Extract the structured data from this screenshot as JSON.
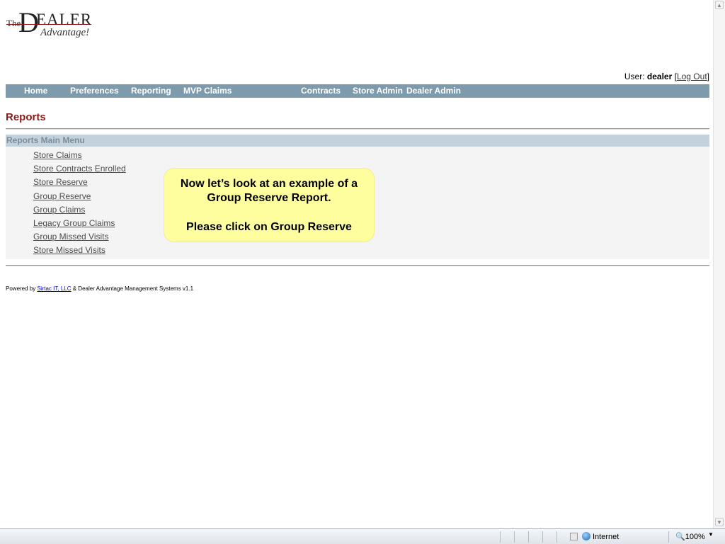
{
  "logo": {
    "the": "The",
    "d": "D",
    "ealer": "EALER",
    "advantage": "Advantage!"
  },
  "user": {
    "prefix": "User:",
    "name": "dealer",
    "bracket_open": "[",
    "logout": "Log Out",
    "bracket_close": "]"
  },
  "nav": {
    "items": [
      "Home",
      "Preferences",
      "Reporting",
      "MVP Claims",
      "Contracts",
      "Store Admin",
      "Dealer Admin"
    ]
  },
  "page": {
    "title": "Reports"
  },
  "menu": {
    "header": "Reports Main Menu",
    "items": [
      "Store Claims",
      "Store Contracts Enrolled",
      "Store Reserve",
      "Group Reserve",
      "Group Claims",
      "Legacy Group Claims",
      "Group Missed Visits",
      "Store Missed Visits"
    ]
  },
  "callout": {
    "line1": "Now let’s look at an example of a",
    "line2": "Group Reserve Report.",
    "line3": "Please click on Group Reserve"
  },
  "footer": {
    "prefix": "Powered by",
    "link": "Sirtac IT, LLC",
    "suffix": "& Dealer Advantage Management Systems v1.1"
  },
  "statusbar": {
    "zone": "Internet",
    "zoom": "100%"
  },
  "colors": {
    "nav_bg": "#7e9aad",
    "title": "#8b1a1a",
    "callout_bg": "#fffe9f",
    "menu_header_bg": "#c3d1dc"
  }
}
